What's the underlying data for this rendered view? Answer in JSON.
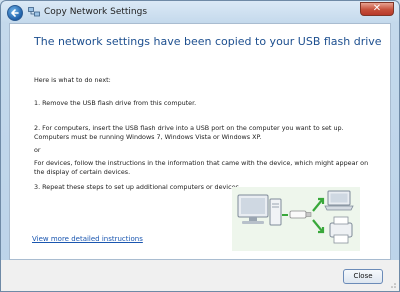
{
  "window": {
    "title": "Copy Network Settings"
  },
  "content": {
    "heading": "The network settings have been copied to your USB flash drive",
    "intro": "Here is what to do next:",
    "step1": "1. Remove the USB flash drive from this computer.",
    "step2": "2. For computers, insert the USB flash drive into a USB port on the computer you want to set up. Computers must be running Windows 7, Windows Vista or Windows XP.",
    "or": "or",
    "devices": "For devices, follow the instructions in the information that came with the device, which might appear on the display of certain devices.",
    "step3": "3. Repeat these steps to set up additional computers or devices.",
    "link": "View more detailed instructions"
  },
  "footer": {
    "close_label": "Close"
  },
  "icons": {
    "back": "back-arrow-icon",
    "network": "network-icon",
    "close": "close-icon"
  }
}
